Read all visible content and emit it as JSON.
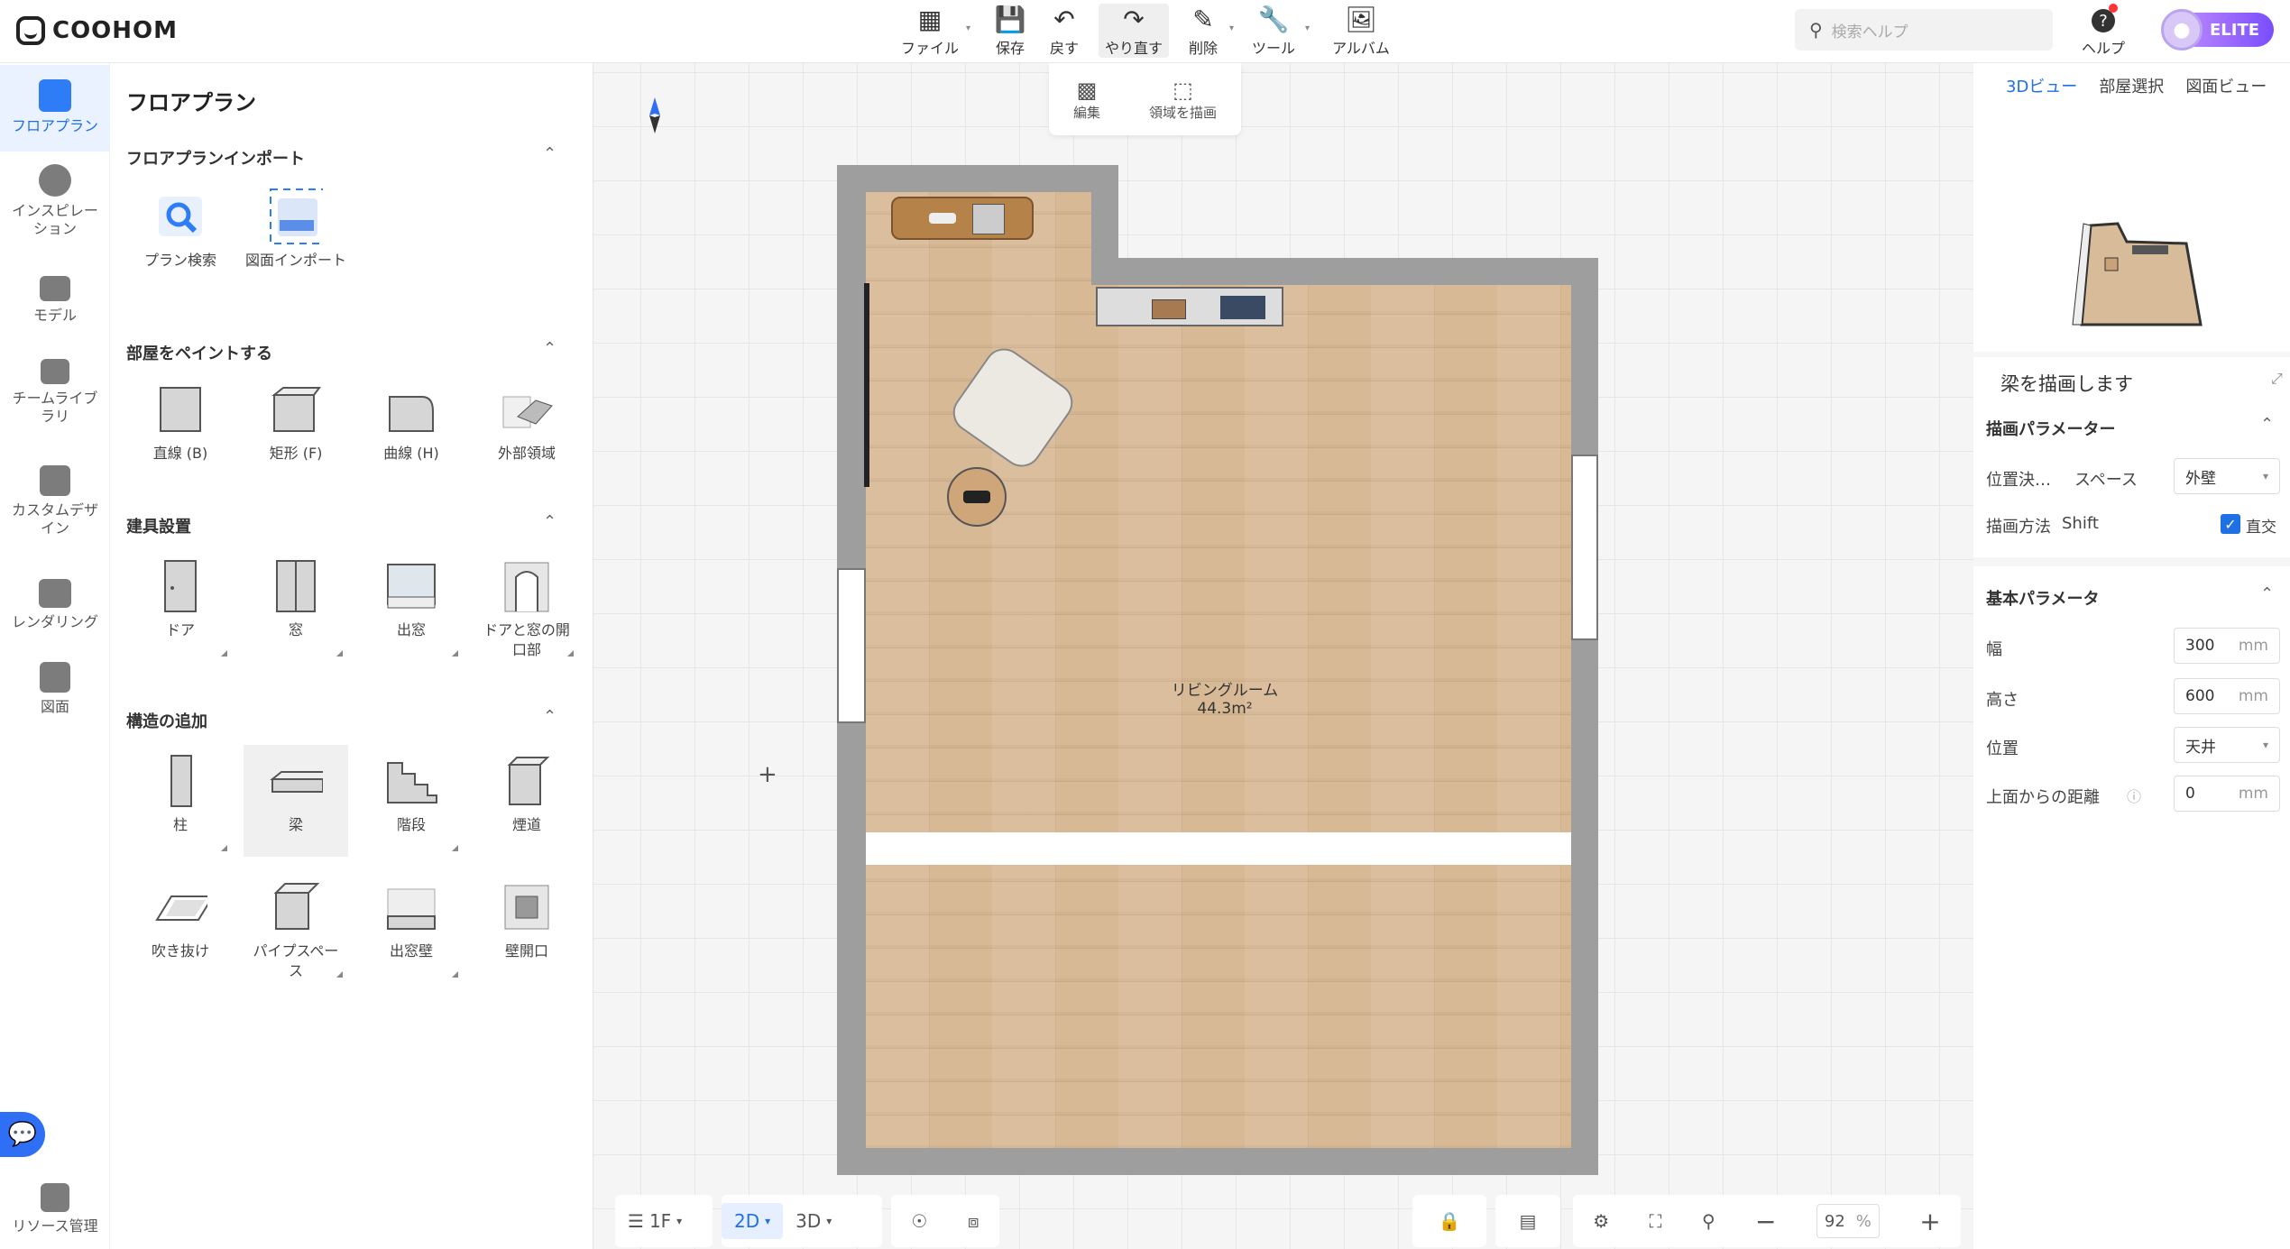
{
  "app": {
    "logo": "COOHOM"
  },
  "toolbar": {
    "file": "ファイル",
    "save": "保存",
    "undo": "戻す",
    "redo": "やり直す",
    "delete": "削除",
    "tools": "ツール",
    "album": "アルバム"
  },
  "search": {
    "placeholder": "検索ヘルプ"
  },
  "help": "ヘルプ",
  "badge": "ELITE",
  "nav": [
    "フロアプラン",
    "インスピレーション",
    "モデル",
    "チームライブラリ",
    "カスタムデザイン",
    "レンダリング",
    "図面",
    "リソース管理"
  ],
  "panel": {
    "title": "フロアプラン",
    "import": {
      "title": "フロアプランインポート",
      "items": [
        "プラン検索",
        "図面インポート"
      ]
    },
    "paint": {
      "title": "部屋をペイントする",
      "items": [
        "直線 (B)",
        "矩形 (F)",
        "曲線 (H)",
        "外部領域"
      ]
    },
    "fixture": {
      "title": "建具設置",
      "items": [
        "ドア",
        "窓",
        "出窓",
        "ドアと窓の開口部"
      ]
    },
    "structure": {
      "title": "構造の追加",
      "items": [
        "柱",
        "梁",
        "階段",
        "煙道",
        "吹き抜け",
        "パイプスペース",
        "出窓壁",
        "壁開口"
      ]
    }
  },
  "floating": {
    "edit": "編集",
    "draw_area": "領域を描画"
  },
  "room": {
    "name": "リビングルーム",
    "area": "44.3m²"
  },
  "bottom": {
    "floor": "1F",
    "view2d": "2D",
    "view3d": "3D",
    "zoom": "92",
    "zoom_unit": "%"
  },
  "right": {
    "tabs": [
      "3Dビュー",
      "部屋選択",
      "図面ビュー"
    ],
    "panel_title": "梁を描画します",
    "draw_params": {
      "title": "描画パラメーター",
      "position_label": "位置決…",
      "space_label": "スペース",
      "space_value": "外壁",
      "method_label": "描画方法",
      "shift": "Shift",
      "ortho": "直交"
    },
    "basic": {
      "title": "基本パラメータ",
      "width_label": "幅",
      "width": "300",
      "height_label": "高さ",
      "height": "600",
      "position_label": "位置",
      "position": "天井",
      "top_dist_label": "上面からの距離",
      "top_dist": "0",
      "unit": "mm"
    }
  }
}
